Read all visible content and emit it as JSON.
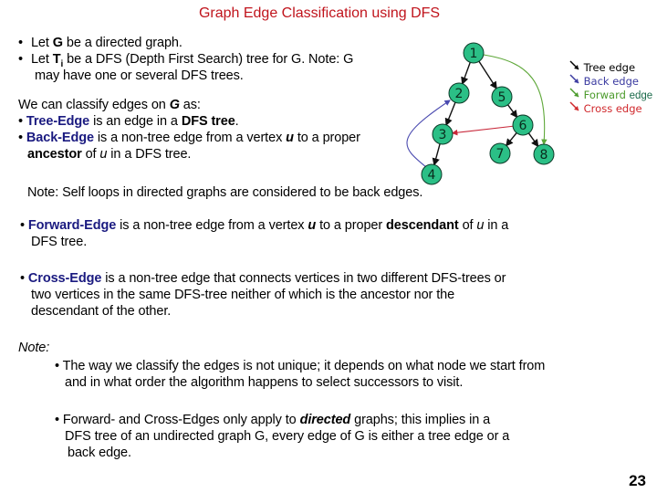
{
  "slide": {
    "title": "Graph Edge Classification using DFS",
    "intro": {
      "bullet1": {
        "pre": "Let ",
        "bold": "G",
        "post": " be a directed graph."
      },
      "bullet2": {
        "pre": "Let ",
        "bold": "T",
        "sub": "i",
        "post": " be a DFS (Depth First Search) tree for G. Note: G",
        "line2": "may have one or several DFS trees."
      }
    },
    "classify": {
      "lead_pre": "We can classify edges on ",
      "lead_bold": "G",
      "lead_post": " as:",
      "tree": {
        "term": "Tree-Edge",
        "pre": " is an edge in a ",
        "bold": "DFS tree",
        "post": "."
      },
      "back": {
        "term": "Back-Edge",
        "pre": " is a non-tree edge from a vertex ",
        "var": "u",
        "mid": " to a proper",
        "bold2": "ancestor",
        "post2_pre": " of ",
        "var2": "u",
        "post2": " in a DFS tree."
      }
    },
    "self_loop_note": "Note: Self loops in directed graphs are considered to be back edges.",
    "forward": {
      "term": "Forward-Edge",
      "pre": " is a non-tree edge from a vertex ",
      "var": "u",
      "mid": " to a proper ",
      "bold": "descendant",
      "post_pre": " of ",
      "var2": "u",
      "post": " in a",
      "line2": "DFS tree."
    },
    "cross": {
      "term": "Cross-Edge",
      "line1": " is a non-tree edge that connects vertices in two different DFS-trees or",
      "line2": "two vertices in the same DFS-tree neither of which is the ancestor nor the",
      "line3": "descendant of the other."
    },
    "note": {
      "label": "Note:",
      "bullet1": {
        "line1": "The way we classify the edges is not unique; it depends on what node we start from",
        "line2": "and in what order the algorithm happens to select successors to visit."
      },
      "bullet2": {
        "pre": "Forward- and Cross-Edges only apply to ",
        "bold": "directed",
        "post": " graphs; this implies in a",
        "line2": "DFS tree of an undirected graph G, every edge of G is either a tree edge or a",
        "line3": "back edge."
      }
    },
    "page_number": "23"
  },
  "graph": {
    "node_color": "#2bbf86",
    "nodes": [
      "1",
      "2",
      "3",
      "4",
      "5",
      "6",
      "7",
      "8"
    ],
    "edges": [
      {
        "from": "1",
        "to": "2",
        "type": "tree"
      },
      {
        "from": "1",
        "to": "5",
        "type": "tree"
      },
      {
        "from": "2",
        "to": "3",
        "type": "tree"
      },
      {
        "from": "3",
        "to": "4",
        "type": "tree"
      },
      {
        "from": "5",
        "to": "6",
        "type": "tree"
      },
      {
        "from": "6",
        "to": "7",
        "type": "tree"
      },
      {
        "from": "6",
        "to": "8",
        "type": "tree"
      },
      {
        "from": "4",
        "to": "2",
        "type": "back"
      },
      {
        "from": "1",
        "to": "8",
        "type": "forward"
      },
      {
        "from": "6",
        "to": "3",
        "type": "cross"
      }
    ],
    "legend": [
      {
        "label": "Tree edge",
        "type": "tree",
        "color": "#000000"
      },
      {
        "label": "Back edge",
        "type": "back",
        "color": "#3a3aa0"
      },
      {
        "label": "Forward",
        "extra": "edge",
        "type": "forward",
        "color": "#4a9a2a",
        "extra_color": "#1a6a4a"
      },
      {
        "label": "Cross edge",
        "type": "cross",
        "color": "#d0282c"
      }
    ],
    "edge_colors": {
      "tree": "#111111",
      "back": "#4b4bb0",
      "forward": "#5fa83a",
      "cross": "#c8283a"
    }
  }
}
